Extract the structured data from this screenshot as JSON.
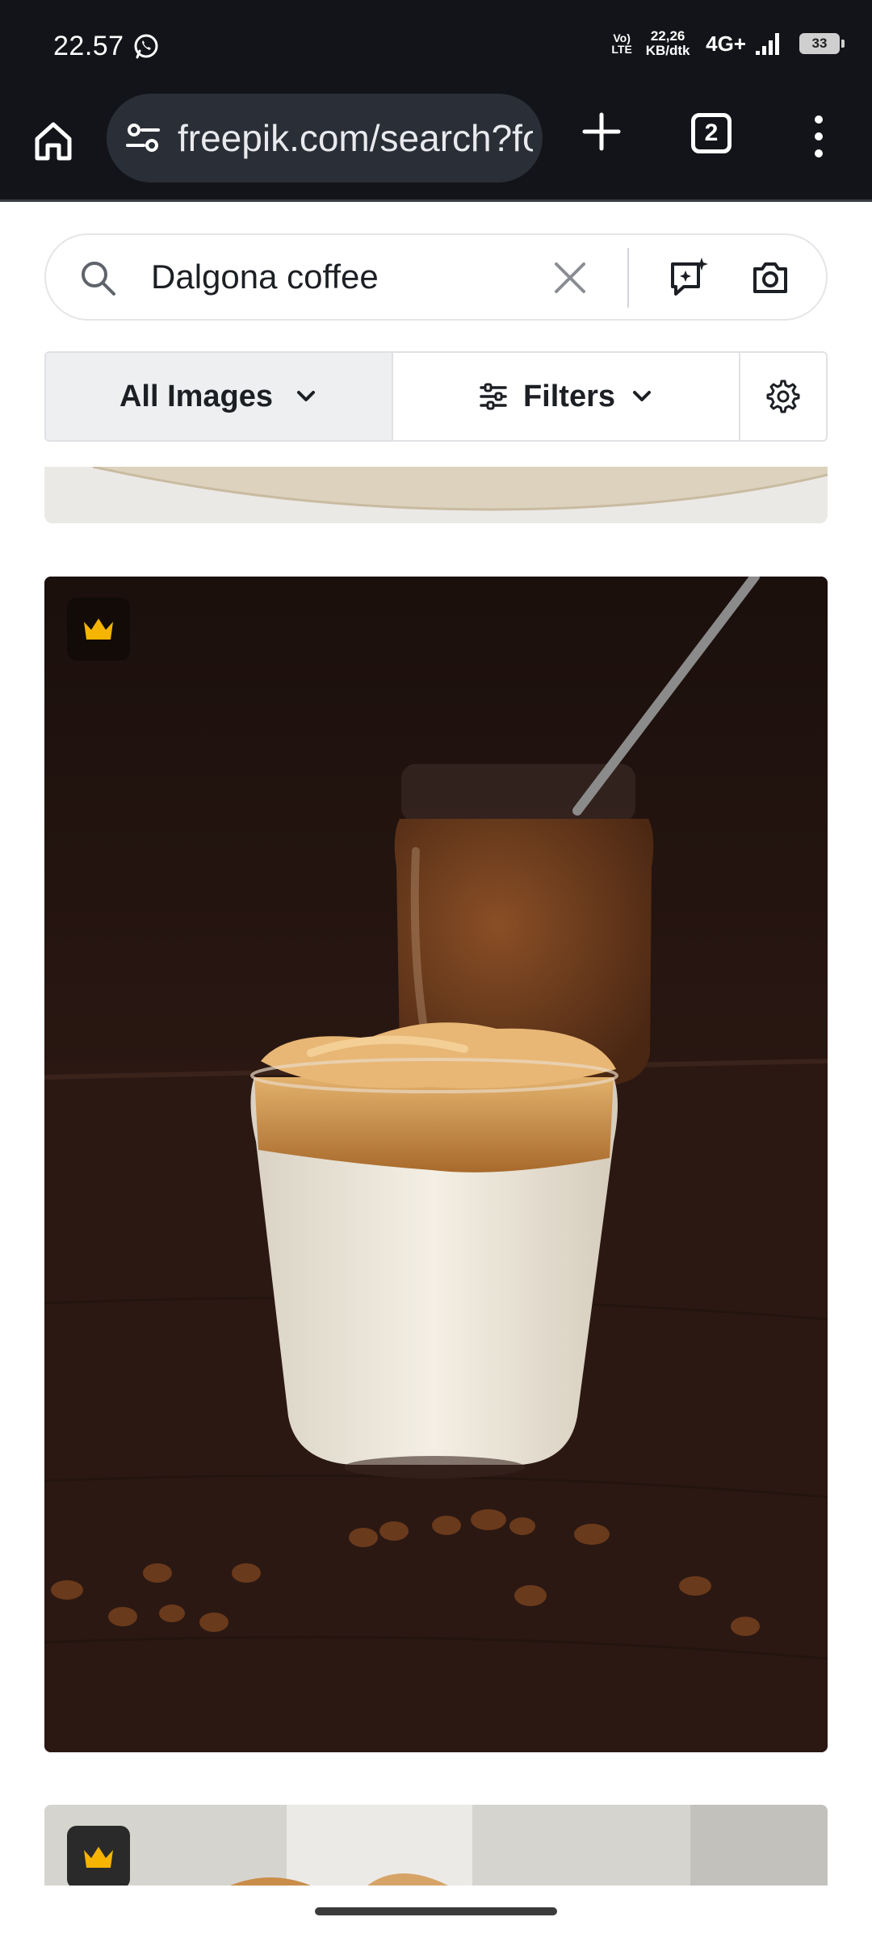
{
  "status_bar": {
    "time": "22.57",
    "volte": "Vo) LTE",
    "net_speed_value": "22,26",
    "net_speed_unit": "KB/dtk",
    "network_type": "4G+",
    "battery": "33"
  },
  "browser": {
    "url": "freepik.com/search?fo",
    "tab_count": "2"
  },
  "search": {
    "query": "Dalgona coffee"
  },
  "filters": {
    "type_label": "All Images",
    "filters_label": "Filters"
  },
  "colors": {
    "toolbar_bg": "#121419",
    "premium_crown": "#f5b400",
    "photo_bg": "#241510"
  },
  "results": [
    {
      "premium": false
    },
    {
      "premium": true
    },
    {
      "premium": true
    }
  ]
}
